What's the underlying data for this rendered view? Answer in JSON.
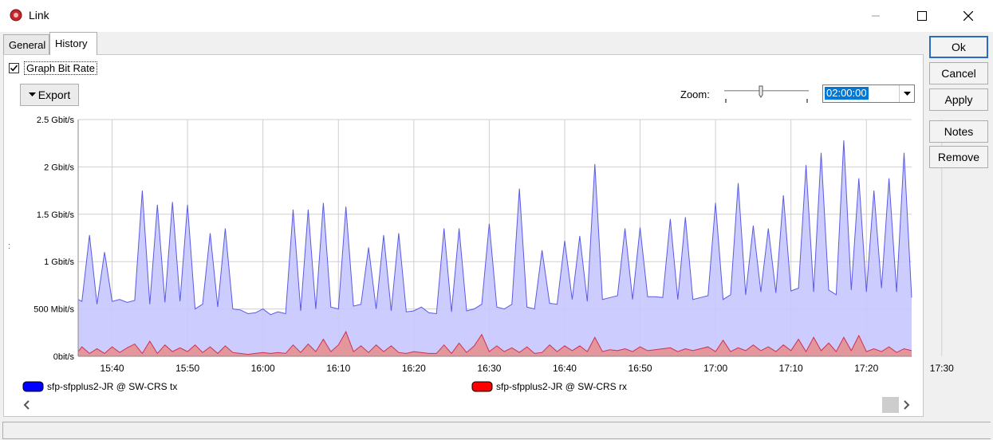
{
  "window": {
    "title": "Link"
  },
  "tabs": [
    {
      "label": "General"
    },
    {
      "label": "History"
    }
  ],
  "graph_option": {
    "label": "Graph Bit Rate",
    "checked": true
  },
  "toolbar": {
    "export_label": "Export",
    "zoom_label": "Zoom:",
    "zoom_value": "02:00:00"
  },
  "side_buttons": {
    "ok": "Ok",
    "cancel": "Cancel",
    "apply": "Apply",
    "notes": "Notes",
    "remove": "Remove"
  },
  "colors": {
    "tx": "#0000ff",
    "rx": "#ff0000"
  },
  "chart_data": {
    "type": "area",
    "xlabels": [
      "15:40",
      "15:50",
      "16:00",
      "16:10",
      "16:20",
      "16:30",
      "16:40",
      "16:50",
      "17:00",
      "17:10",
      "17:20",
      "17:30"
    ],
    "yticks": [
      {
        "value": 0,
        "label": "0bit/s"
      },
      {
        "value": 0.5,
        "label": "500 Mbit/s"
      },
      {
        "value": 1,
        "label": "1 Gbit/s"
      },
      {
        "value": 1.5,
        "label": "1.5 Gbit/s"
      },
      {
        "value": 2,
        "label": "2 Gbit/s"
      },
      {
        "value": 2.5,
        "label": "2.5 Gbit/s"
      }
    ],
    "x_range_minutes": [
      15.5,
      126
    ],
    "ylim": [
      0,
      2.5
    ],
    "y_unit": "Gbit/s",
    "grid": true,
    "legend_position": "bottom",
    "series": [
      {
        "name": "sfp-sfpplus2-JR @ SW-CRS tx",
        "color": "#0000ff",
        "x": [
          15.5,
          16,
          17,
          18,
          19,
          20,
          21,
          22,
          23,
          24,
          25,
          26,
          27,
          28,
          29,
          30,
          31,
          32,
          33,
          34,
          35,
          36,
          37,
          38,
          39,
          40,
          41,
          42,
          43,
          44,
          45,
          46,
          47,
          48,
          49,
          50,
          51,
          52,
          53,
          54,
          55,
          56,
          57,
          58,
          59,
          60,
          61,
          62,
          63,
          64,
          65,
          66,
          67,
          68,
          69,
          70,
          71,
          72,
          73,
          74,
          75,
          76,
          77,
          78,
          79,
          80,
          81,
          82,
          83,
          84,
          85,
          86,
          87,
          88,
          89,
          90,
          91,
          92,
          93,
          94,
          95,
          96,
          97,
          98,
          99,
          100,
          101,
          102,
          103,
          104,
          105,
          106,
          107,
          108,
          109,
          110,
          111,
          112,
          113,
          114,
          115,
          116,
          117,
          118,
          119,
          120,
          121,
          122,
          123,
          124,
          125,
          126
        ],
        "values": [
          0.6,
          0.58,
          1.28,
          0.55,
          1.1,
          0.58,
          0.6,
          0.57,
          0.59,
          1.75,
          0.55,
          1.6,
          0.57,
          1.63,
          0.58,
          1.6,
          0.5,
          0.55,
          1.3,
          0.52,
          1.35,
          0.5,
          0.49,
          0.45,
          0.46,
          0.5,
          0.44,
          0.47,
          0.45,
          1.55,
          0.48,
          1.55,
          0.5,
          1.62,
          0.52,
          0.5,
          1.58,
          0.53,
          0.55,
          1.15,
          0.5,
          1.28,
          0.48,
          1.3,
          0.47,
          0.48,
          0.52,
          0.46,
          0.45,
          1.35,
          0.47,
          1.35,
          0.48,
          0.5,
          0.55,
          1.4,
          0.52,
          0.5,
          0.55,
          1.77,
          0.52,
          0.5,
          1.12,
          0.56,
          0.55,
          1.22,
          0.6,
          1.27,
          0.58,
          2.03,
          0.6,
          0.62,
          0.64,
          1.35,
          0.6,
          1.36,
          0.63,
          0.63,
          0.62,
          1.45,
          0.6,
          1.47,
          0.6,
          0.62,
          0.64,
          1.62,
          0.6,
          0.65,
          1.83,
          0.65,
          1.38,
          0.68,
          1.35,
          0.67,
          1.7,
          0.69,
          0.72,
          2.02,
          0.68,
          2.15,
          0.7,
          0.65,
          2.28,
          0.7,
          1.88,
          0.68,
          1.75,
          0.72,
          1.88,
          0.68,
          2.15,
          0.62
        ],
        "fill": "#c6c6ff",
        "stroke": "#5a5ae6"
      },
      {
        "name": "sfp-sfpplus2-JR @ SW-CRS rx",
        "color": "#ff0000",
        "x": [
          15.5,
          16,
          17,
          18,
          19,
          20,
          21,
          22,
          23,
          24,
          25,
          26,
          27,
          28,
          29,
          30,
          31,
          32,
          33,
          34,
          35,
          36,
          37,
          38,
          39,
          40,
          41,
          42,
          43,
          44,
          45,
          46,
          47,
          48,
          49,
          50,
          51,
          52,
          53,
          54,
          55,
          56,
          57,
          58,
          59,
          60,
          61,
          62,
          63,
          64,
          65,
          66,
          67,
          68,
          69,
          70,
          71,
          72,
          73,
          74,
          75,
          76,
          77,
          78,
          79,
          80,
          81,
          82,
          83,
          84,
          85,
          86,
          87,
          88,
          89,
          90,
          91,
          92,
          93,
          94,
          95,
          96,
          97,
          98,
          99,
          100,
          101,
          102,
          103,
          104,
          105,
          106,
          107,
          108,
          109,
          110,
          111,
          112,
          113,
          114,
          115,
          116,
          117,
          118,
          119,
          120,
          121,
          122,
          123,
          124,
          125,
          126
        ],
        "values": [
          0.05,
          0.1,
          0.03,
          0.08,
          0.03,
          0.1,
          0.04,
          0.09,
          0.13,
          0.03,
          0.16,
          0.03,
          0.12,
          0.05,
          0.09,
          0.05,
          0.12,
          0.04,
          0.1,
          0.03,
          0.11,
          0.04,
          0.03,
          0.02,
          0.03,
          0.04,
          0.03,
          0.04,
          0.03,
          0.12,
          0.04,
          0.13,
          0.05,
          0.18,
          0.05,
          0.12,
          0.26,
          0.05,
          0.11,
          0.04,
          0.12,
          0.05,
          0.11,
          0.04,
          0.03,
          0.05,
          0.04,
          0.03,
          0.03,
          0.12,
          0.03,
          0.14,
          0.04,
          0.11,
          0.23,
          0.05,
          0.11,
          0.05,
          0.09,
          0.04,
          0.1,
          0.03,
          0.04,
          0.12,
          0.05,
          0.11,
          0.06,
          0.11,
          0.05,
          0.2,
          0.05,
          0.07,
          0.06,
          0.08,
          0.05,
          0.1,
          0.06,
          0.07,
          0.08,
          0.09,
          0.05,
          0.08,
          0.06,
          0.08,
          0.1,
          0.05,
          0.17,
          0.05,
          0.09,
          0.06,
          0.12,
          0.06,
          0.1,
          0.05,
          0.12,
          0.06,
          0.18,
          0.05,
          0.2,
          0.06,
          0.14,
          0.05,
          0.2,
          0.06,
          0.22,
          0.05,
          0.08,
          0.05,
          0.1,
          0.04,
          0.08,
          0.06
        ],
        "fill": "#e69090",
        "stroke": "#d03050"
      }
    ]
  }
}
